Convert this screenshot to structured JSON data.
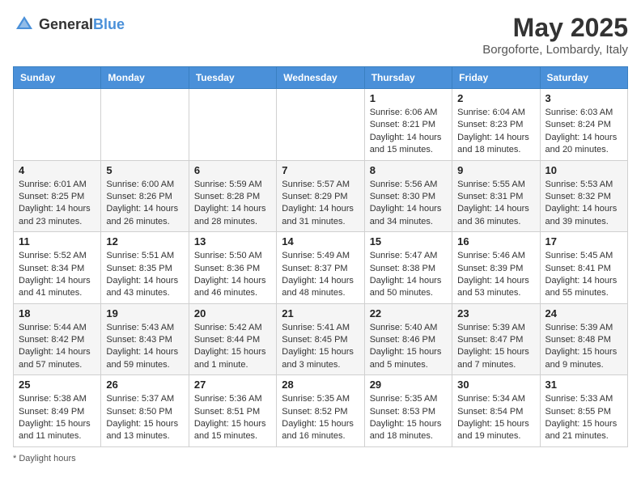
{
  "header": {
    "logo_general": "General",
    "logo_blue": "Blue",
    "title": "May 2025",
    "location": "Borgoforte, Lombardy, Italy"
  },
  "days_of_week": [
    "Sunday",
    "Monday",
    "Tuesday",
    "Wednesday",
    "Thursday",
    "Friday",
    "Saturday"
  ],
  "weeks": [
    [
      {
        "day": "",
        "info": ""
      },
      {
        "day": "",
        "info": ""
      },
      {
        "day": "",
        "info": ""
      },
      {
        "day": "",
        "info": ""
      },
      {
        "day": "1",
        "info": "Sunrise: 6:06 AM\nSunset: 8:21 PM\nDaylight: 14 hours and 15 minutes."
      },
      {
        "day": "2",
        "info": "Sunrise: 6:04 AM\nSunset: 8:23 PM\nDaylight: 14 hours and 18 minutes."
      },
      {
        "day": "3",
        "info": "Sunrise: 6:03 AM\nSunset: 8:24 PM\nDaylight: 14 hours and 20 minutes."
      }
    ],
    [
      {
        "day": "4",
        "info": "Sunrise: 6:01 AM\nSunset: 8:25 PM\nDaylight: 14 hours and 23 minutes."
      },
      {
        "day": "5",
        "info": "Sunrise: 6:00 AM\nSunset: 8:26 PM\nDaylight: 14 hours and 26 minutes."
      },
      {
        "day": "6",
        "info": "Sunrise: 5:59 AM\nSunset: 8:28 PM\nDaylight: 14 hours and 28 minutes."
      },
      {
        "day": "7",
        "info": "Sunrise: 5:57 AM\nSunset: 8:29 PM\nDaylight: 14 hours and 31 minutes."
      },
      {
        "day": "8",
        "info": "Sunrise: 5:56 AM\nSunset: 8:30 PM\nDaylight: 14 hours and 34 minutes."
      },
      {
        "day": "9",
        "info": "Sunrise: 5:55 AM\nSunset: 8:31 PM\nDaylight: 14 hours and 36 minutes."
      },
      {
        "day": "10",
        "info": "Sunrise: 5:53 AM\nSunset: 8:32 PM\nDaylight: 14 hours and 39 minutes."
      }
    ],
    [
      {
        "day": "11",
        "info": "Sunrise: 5:52 AM\nSunset: 8:34 PM\nDaylight: 14 hours and 41 minutes."
      },
      {
        "day": "12",
        "info": "Sunrise: 5:51 AM\nSunset: 8:35 PM\nDaylight: 14 hours and 43 minutes."
      },
      {
        "day": "13",
        "info": "Sunrise: 5:50 AM\nSunset: 8:36 PM\nDaylight: 14 hours and 46 minutes."
      },
      {
        "day": "14",
        "info": "Sunrise: 5:49 AM\nSunset: 8:37 PM\nDaylight: 14 hours and 48 minutes."
      },
      {
        "day": "15",
        "info": "Sunrise: 5:47 AM\nSunset: 8:38 PM\nDaylight: 14 hours and 50 minutes."
      },
      {
        "day": "16",
        "info": "Sunrise: 5:46 AM\nSunset: 8:39 PM\nDaylight: 14 hours and 53 minutes."
      },
      {
        "day": "17",
        "info": "Sunrise: 5:45 AM\nSunset: 8:41 PM\nDaylight: 14 hours and 55 minutes."
      }
    ],
    [
      {
        "day": "18",
        "info": "Sunrise: 5:44 AM\nSunset: 8:42 PM\nDaylight: 14 hours and 57 minutes."
      },
      {
        "day": "19",
        "info": "Sunrise: 5:43 AM\nSunset: 8:43 PM\nDaylight: 14 hours and 59 minutes."
      },
      {
        "day": "20",
        "info": "Sunrise: 5:42 AM\nSunset: 8:44 PM\nDaylight: 15 hours and 1 minute."
      },
      {
        "day": "21",
        "info": "Sunrise: 5:41 AM\nSunset: 8:45 PM\nDaylight: 15 hours and 3 minutes."
      },
      {
        "day": "22",
        "info": "Sunrise: 5:40 AM\nSunset: 8:46 PM\nDaylight: 15 hours and 5 minutes."
      },
      {
        "day": "23",
        "info": "Sunrise: 5:39 AM\nSunset: 8:47 PM\nDaylight: 15 hours and 7 minutes."
      },
      {
        "day": "24",
        "info": "Sunrise: 5:39 AM\nSunset: 8:48 PM\nDaylight: 15 hours and 9 minutes."
      }
    ],
    [
      {
        "day": "25",
        "info": "Sunrise: 5:38 AM\nSunset: 8:49 PM\nDaylight: 15 hours and 11 minutes."
      },
      {
        "day": "26",
        "info": "Sunrise: 5:37 AM\nSunset: 8:50 PM\nDaylight: 15 hours and 13 minutes."
      },
      {
        "day": "27",
        "info": "Sunrise: 5:36 AM\nSunset: 8:51 PM\nDaylight: 15 hours and 15 minutes."
      },
      {
        "day": "28",
        "info": "Sunrise: 5:35 AM\nSunset: 8:52 PM\nDaylight: 15 hours and 16 minutes."
      },
      {
        "day": "29",
        "info": "Sunrise: 5:35 AM\nSunset: 8:53 PM\nDaylight: 15 hours and 18 minutes."
      },
      {
        "day": "30",
        "info": "Sunrise: 5:34 AM\nSunset: 8:54 PM\nDaylight: 15 hours and 19 minutes."
      },
      {
        "day": "31",
        "info": "Sunrise: 5:33 AM\nSunset: 8:55 PM\nDaylight: 15 hours and 21 minutes."
      }
    ]
  ],
  "footer": "Daylight hours"
}
